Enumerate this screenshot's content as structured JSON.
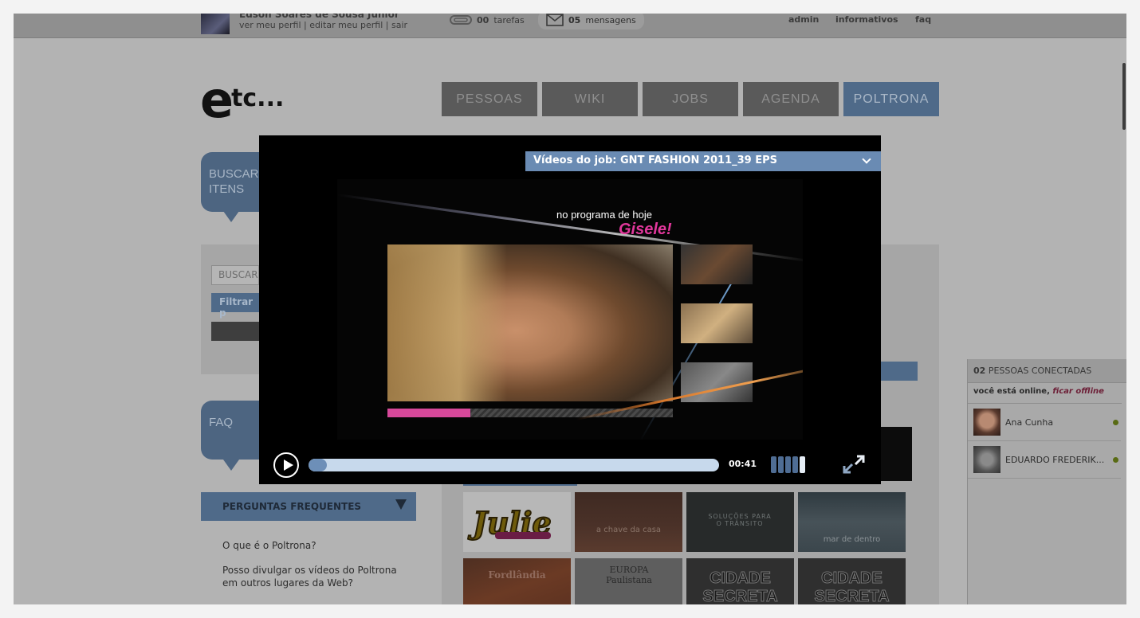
{
  "topbar": {
    "user_name": "Edson Soares de Sousa Junior",
    "user_links": "ver meu perfil | editar meu perfil | sair",
    "tasks_count": "00",
    "tasks_label": "tarefas",
    "messages_count": "05",
    "messages_label": "mensagens",
    "links": [
      "admin",
      "informativos",
      "faq"
    ]
  },
  "logo": {
    "big": "e",
    "small": "tc..."
  },
  "nav": [
    "PESSOAS",
    "WIKI",
    "JOBS",
    "AGENDA",
    "POLTRONA"
  ],
  "nav_active": "POLTRONA",
  "search_bubble": {
    "line1": "BUSCAR",
    "line2": "ITENS"
  },
  "search_panel": {
    "placeholder": "BUSCAR",
    "filter_label": "Filtrar p"
  },
  "faq_bubble": "FAQ",
  "faq": {
    "header": "PERGUNTAS FREQUENTES",
    "items": [
      "O que é o Poltrona?",
      "Posso divulgar os vídeos do Poltrona em outros lugares da Web?"
    ]
  },
  "thumbnails": [
    {
      "label": "",
      "kind": "julie"
    },
    {
      "label": "a chave da casa",
      "kind": "brown"
    },
    {
      "label": "SOLUÇÕES PARA O TRÂNSITO",
      "kind": "dark"
    },
    {
      "label": "mar de dentro",
      "kind": "sea"
    },
    {
      "label": "Fordlândia",
      "kind": "orange"
    },
    {
      "label": "EUROPA Paulistana",
      "kind": "grey"
    },
    {
      "label": "CIDADE SECRETA",
      "kind": "stone"
    },
    {
      "label": "CIDADE SECRETA",
      "kind": "stone"
    }
  ],
  "online": {
    "count": "02",
    "label": "PESSOAS CONECTADAS",
    "status_text": "você está online,",
    "status_link": "ficar offline",
    "people": [
      "Ana Cunha",
      "EDUARDO FREDERIK..."
    ]
  },
  "video": {
    "title": "Vídeos do job: GNT FASHION 2011_39 EPS",
    "overlay_line1": "no programa de hoje",
    "overlay_line2": "Gisele!",
    "in_video_progress": 0.29,
    "time": "00:41",
    "progress": 0.04,
    "volume_level": 5,
    "volume_max": 5
  },
  "colors": {
    "accent_blue": "#6a8bb3",
    "nav_active": "#4f6a89",
    "pink": "#e1379b",
    "online_dot": "#596b14"
  }
}
